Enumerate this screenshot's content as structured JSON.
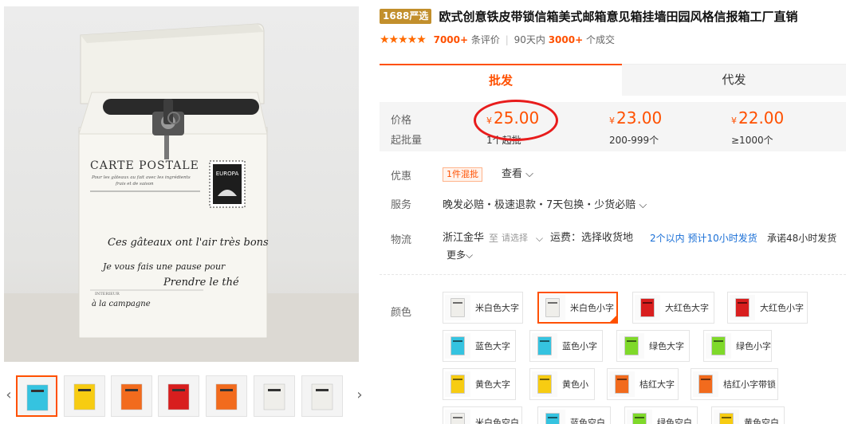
{
  "product": {
    "badge": "1688严选",
    "title": "欧式创意铁皮带锁信箱美式邮箱意见箱挂墙田园风格信报箱工厂直销"
  },
  "rating": {
    "stars": "★★★★★",
    "reviews_count": "7000+",
    "reviews_suffix": "条评价",
    "period": "90天内",
    "sold_count": "3000+",
    "sold_suffix": "个成交"
  },
  "tabs": [
    {
      "label": "批发"
    },
    {
      "label": "代发"
    }
  ],
  "price": {
    "label_price": "价格",
    "label_moq": "起批量",
    "currency": "¥",
    "tiers": [
      {
        "price": "25.00",
        "moq": "1个起批"
      },
      {
        "price": "23.00",
        "moq": "200-999个"
      },
      {
        "price": "22.00",
        "moq": "≥1000个"
      }
    ]
  },
  "promo": {
    "label": "优惠",
    "tag": "1件混批",
    "view": "查看 ⌵"
  },
  "service": {
    "label": "服务",
    "text": "晚发必赔・极速退款・7天包换・少货必赔 ⌵"
  },
  "logistics": {
    "label": "物流",
    "from": "浙江金华",
    "to_word": "至",
    "select_placeholder": "请选择",
    "chevron": "⌵",
    "shipping": "运费：选择收货地",
    "time_info": "2个以内  预计10小时发货",
    "promise": "承诺48小时发货",
    "more": "更多⌵"
  },
  "color": {
    "label": "颜色",
    "options": [
      {
        "label": "米白色大字",
        "color": "#efeeea"
      },
      {
        "label": "米白色小字",
        "color": "#efeeea",
        "selected": true
      },
      {
        "label": "大红色大字",
        "color": "#d81e1e"
      },
      {
        "label": "大红色小字",
        "color": "#d81e1e"
      },
      {
        "label": "蓝色大字",
        "color": "#35c3e0"
      },
      {
        "label": "蓝色小字",
        "color": "#35c3e0"
      },
      {
        "label": "绿色大字",
        "color": "#7fd92a"
      },
      {
        "label": "绿色小字",
        "color": "#7fd92a"
      },
      {
        "label": "黄色大字",
        "color": "#f7cc12"
      },
      {
        "label": "黄色小",
        "color": "#f7cc12"
      },
      {
        "label": "桔红大字",
        "color": "#f26b1d"
      },
      {
        "label": "桔红小字带锁",
        "color": "#f26b1d"
      },
      {
        "label": "米白色空白",
        "color": "#efeeea"
      },
      {
        "label": "蓝色空白",
        "color": "#35c3e0"
      },
      {
        "label": "绿色空白",
        "color": "#7fd92a"
      },
      {
        "label": "黄色空白",
        "color": "#f7cc12"
      }
    ]
  },
  "main_image": {
    "headline": "CARTE POSTALE",
    "line1": "Pour les gâteaux au fait avec les ingrédients",
    "line2": "frais et de saison",
    "stamp_text": "EUROPA",
    "script1": "Ces gâteaux ont l'air très bons",
    "script2": "Je vous fais une pause pour",
    "script3": "Prendre le thé",
    "script4": "à la campagne",
    "small_print": "INTERIEUR"
  },
  "thumbnails": [
    {
      "color": "#35c3e0",
      "selected": true
    },
    {
      "color": "#f7cc12"
    },
    {
      "color": "#f26b1d"
    },
    {
      "color": "#d81e1e"
    },
    {
      "color": "#f26b1d"
    },
    {
      "color": "#efeeea"
    },
    {
      "color": "#efeeea"
    },
    {
      "color": "#efeeea"
    }
  ],
  "nav": {
    "prev": "‹",
    "next": "›"
  },
  "theme": {
    "accent": "#ff5000",
    "circle": "#e81c1c",
    "badge": "#c28f2c"
  }
}
